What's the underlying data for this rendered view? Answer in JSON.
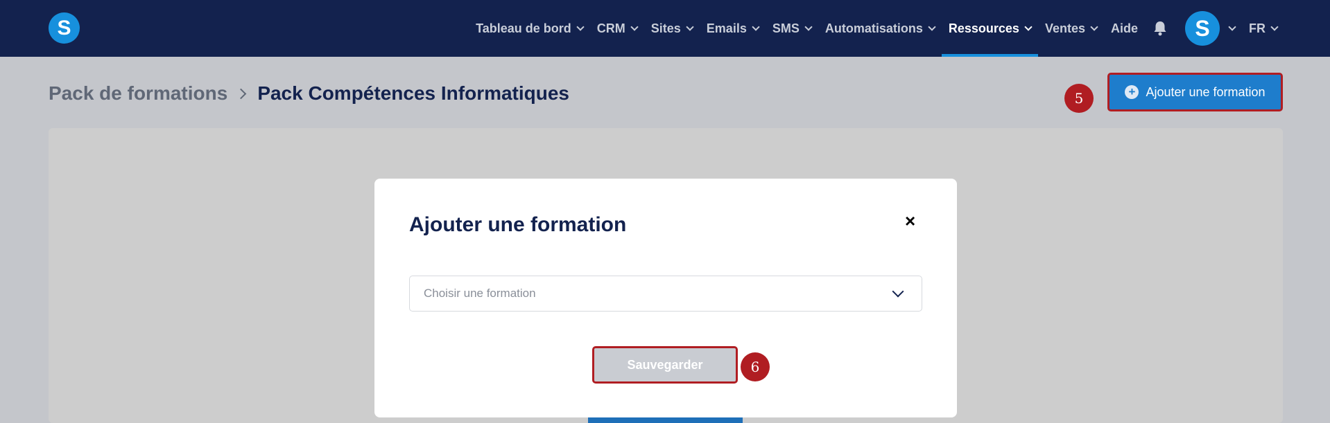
{
  "navbar": {
    "logo_letter": "S",
    "items": [
      {
        "label": "Tableau de bord",
        "has_dropdown": true
      },
      {
        "label": "CRM",
        "has_dropdown": true
      },
      {
        "label": "Sites",
        "has_dropdown": true
      },
      {
        "label": "Emails",
        "has_dropdown": true
      },
      {
        "label": "SMS",
        "has_dropdown": true
      },
      {
        "label": "Automatisations",
        "has_dropdown": true
      },
      {
        "label": "Ressources",
        "has_dropdown": true,
        "active": true
      },
      {
        "label": "Ventes",
        "has_dropdown": true
      },
      {
        "label": "Aide",
        "has_dropdown": false
      }
    ],
    "notifications_icon": "bell-icon",
    "avatar_letter": "S",
    "language": "FR"
  },
  "breadcrumb": {
    "parent": "Pack de formations",
    "current": "Pack Compétences Informatiques"
  },
  "header_actions": {
    "add_button_label": "Ajouter une formation",
    "add_button_icon": "plus-circle-icon"
  },
  "annotations": {
    "step_5": "5",
    "step_6": "6"
  },
  "modal": {
    "title": "Ajouter une formation",
    "close_glyph": "×",
    "select_placeholder": "Choisir une formation",
    "save_label": "Sauvegarder"
  },
  "colors": {
    "navbar": "#13224e",
    "accent": "#1790dd",
    "highlight": "#b01d22"
  }
}
